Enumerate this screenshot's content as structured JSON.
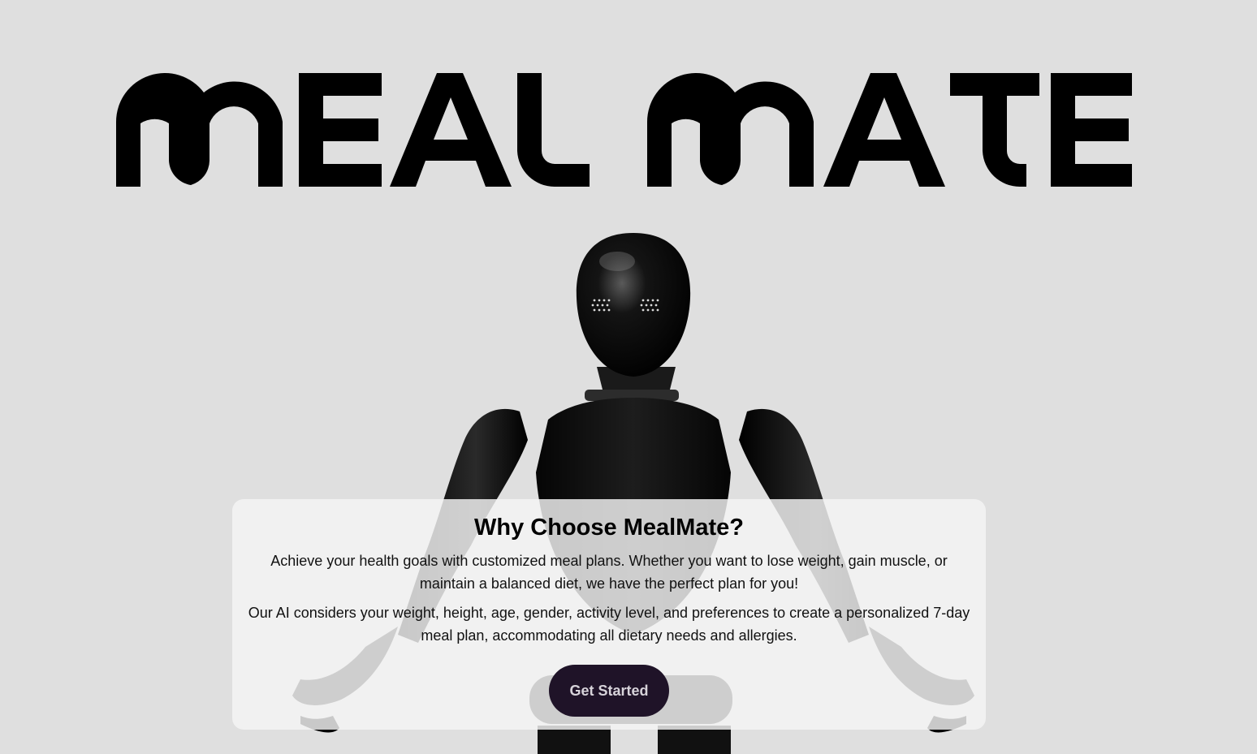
{
  "brand": {
    "logo_text": "MEAL MATE"
  },
  "hero": {
    "image_name": "humanoid-robot"
  },
  "info": {
    "title": "Why Choose MealMate?",
    "paragraph_1": "Achieve your health goals with customized meal plans. Whether you want to lose weight, gain muscle, or maintain a balanced diet, we have the perfect plan for you!",
    "paragraph_2": "Our AI considers your weight, height, age, gender, activity level, and preferences to create a personalized 7-day meal plan, accommodating all dietary needs and allergies.",
    "cta_label": "Get Started"
  },
  "colors": {
    "background": "#dfdfdf",
    "logo": "#000000",
    "card": "#f2f2f2",
    "button": "#1f1328",
    "button_text": "#d7d3da"
  }
}
